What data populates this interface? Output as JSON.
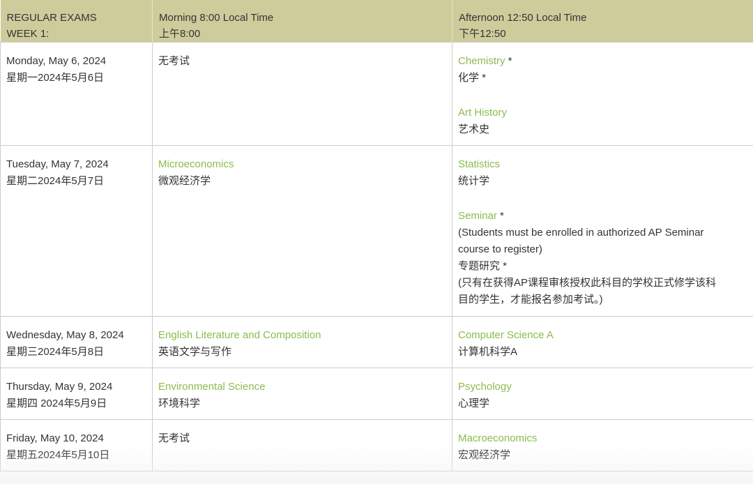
{
  "header": {
    "col1": [
      "REGULAR EXAMS",
      "WEEK 1:"
    ],
    "col2": [
      "Morning 8:00 Local Time",
      "上午8:00"
    ],
    "col3": [
      "Afternoon 12:50 Local Time",
      "下午12:50"
    ]
  },
  "rows": [
    {
      "date_en": "Monday, May 6, 2024",
      "date_zh": "星期一2024年5月6日",
      "morning": {
        "none": "无考试"
      },
      "afternoon": [
        {
          "subject": "Chemistry",
          "suffix": " *",
          "zh": "化学 *"
        },
        {
          "subject": "Art History",
          "suffix": "",
          "zh": "艺术史"
        }
      ]
    },
    {
      "date_en": "Tuesday, May 7, 2024",
      "date_zh": "星期二2024年5月7日",
      "morning": {
        "subject": "Microeconomics",
        "zh": "微观经济学"
      },
      "afternoon": [
        {
          "subject": "Statistics",
          "suffix": "",
          "zh": "统计学"
        },
        {
          "subject": "Seminar",
          "suffix": " *",
          "note_en_1": "(Students must be enrolled in authorized AP Seminar",
          "note_en_2": "course to register)",
          "zh": "专题研究 *",
          "note_zh_1": "(只有在获得AP课程审核授权此科目的学校正式修学该科",
          "note_zh_2": "目的学生，才能报名参加考试。)"
        }
      ]
    },
    {
      "date_en": "Wednesday, May 8, 2024",
      "date_zh": "星期三2024年5月8日",
      "morning": {
        "subject": "English Literature and Composition",
        "zh": "英语文学与写作"
      },
      "afternoon": [
        {
          "subject": "Computer Science A",
          "suffix": "",
          "zh": "计算机科学A"
        }
      ]
    },
    {
      "date_en": "Thursday, May 9, 2024",
      "date_zh": "星期四 2024年5月9日",
      "morning": {
        "subject": "Environmental Science",
        "zh": "环境科学"
      },
      "afternoon": [
        {
          "subject": "Psychology",
          "suffix": "",
          "zh": "心理学"
        }
      ]
    },
    {
      "date_en": "Friday, May 10, 2024",
      "date_zh": "星期五2024年5月10日",
      "morning": {
        "none": "无考试"
      },
      "afternoon": [
        {
          "subject": "Macroeconomics",
          "suffix": "",
          "zh": "宏观经济学"
        }
      ]
    }
  ],
  "colors": {
    "header_bg": "#cfcc9c",
    "link": "#8bbb4e",
    "text": "#333333",
    "border": "#cccccc"
  }
}
